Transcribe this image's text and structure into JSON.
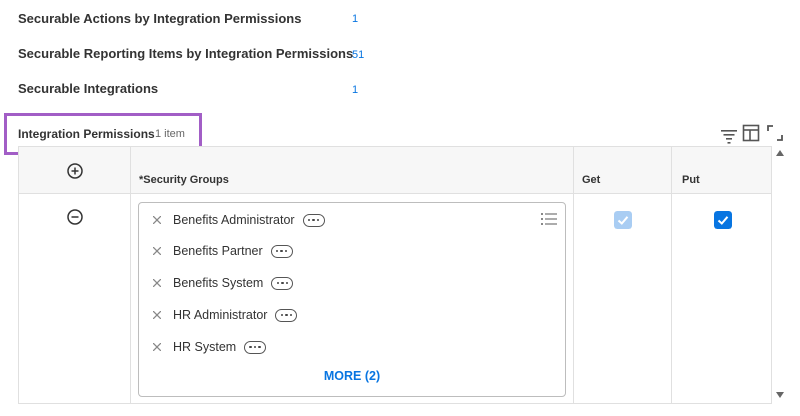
{
  "summary": [
    {
      "label": "Securable Actions by Integration Permissions",
      "count": "1"
    },
    {
      "label": "Securable Reporting Items by Integration Permissions",
      "count": "51"
    },
    {
      "label": "Securable Integrations",
      "count": "1"
    }
  ],
  "section": {
    "title": "Integration Permissions",
    "count": "1 item"
  },
  "toolbar": {
    "icons": [
      "filter-icon",
      "columns-icon",
      "expand-icon"
    ]
  },
  "grid": {
    "columns": {
      "security_groups": "*Security Groups",
      "get": "Get",
      "put": "Put"
    },
    "row": {
      "security_groups": [
        "Benefits Administrator",
        "Benefits Partner",
        "Benefits System",
        "HR Administrator",
        "HR System"
      ],
      "more_label": "MORE (2)",
      "get_checked": true,
      "get_disabled": true,
      "put_checked": true
    }
  },
  "colors": {
    "accent": "#0875e1",
    "highlight_border": "#a25ec6",
    "disabled_check": "#a9cdf3"
  }
}
